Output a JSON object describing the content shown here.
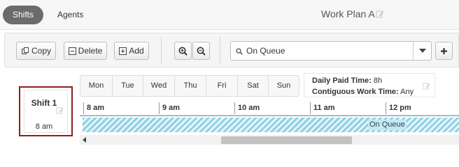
{
  "tabs": [
    {
      "label": "Shifts",
      "active": true
    },
    {
      "label": "Agents",
      "active": false
    }
  ],
  "plan": {
    "title": "Work Plan A",
    "edit_icon": "edit-icon"
  },
  "toolbar": {
    "copy_label": "Copy",
    "delete_label": "Delete",
    "add_label": "Add",
    "zoom_in_icon": "zoom-in-icon",
    "zoom_out_icon": "zoom-out-icon",
    "activity_select": {
      "value": "On Queue",
      "icon": "search-icon"
    },
    "add_activity_icon": "plus-icon"
  },
  "shift": {
    "name": "Shift 1",
    "start": "8 am",
    "selected": true
  },
  "days": [
    "Mon",
    "Tue",
    "Wed",
    "Thu",
    "Fri",
    "Sat",
    "Sun"
  ],
  "summary": {
    "daily_paid_label": "Daily Paid Time:",
    "daily_paid_value": "8h",
    "contiguous_label": "Contiguous Work Time:",
    "contiguous_value": "Any"
  },
  "timeline": {
    "ticks": [
      "8 am",
      "9 am",
      "10 am",
      "11 am",
      "12 pm"
    ],
    "activity_label": "On Queue"
  },
  "colors": {
    "active_tab": "#6b6b6b",
    "selected_border": "#8f1d1d",
    "activity_fill": "#8fd0e4"
  }
}
